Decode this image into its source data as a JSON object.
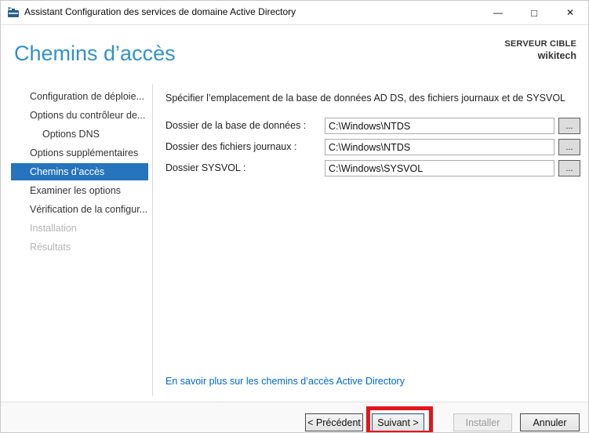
{
  "titlebar": {
    "title": "Assistant Configuration des services de domaine Active Directory",
    "controls": {
      "minimize_glyph": "—",
      "maximize_glyph": "□",
      "close_glyph": "✕"
    }
  },
  "header": {
    "page_title": "Chemins d’accès",
    "target_server_label": "SERVEUR CIBLE",
    "target_server_name": "wikitech"
  },
  "sidebar": {
    "items": [
      {
        "label": "Configuration de déploie...",
        "state": "normal",
        "indent": 0
      },
      {
        "label": "Options du contrôleur de...",
        "state": "normal",
        "indent": 0
      },
      {
        "label": "Options DNS",
        "state": "normal",
        "indent": 1
      },
      {
        "label": "Options supplémentaires",
        "state": "normal",
        "indent": 0
      },
      {
        "label": "Chemins d’accès",
        "state": "selected",
        "indent": 0
      },
      {
        "label": "Examiner les options",
        "state": "normal",
        "indent": 0
      },
      {
        "label": "Vérification de la configur...",
        "state": "normal",
        "indent": 0
      },
      {
        "label": "Installation",
        "state": "disabled",
        "indent": 0
      },
      {
        "label": "Résultats",
        "state": "disabled",
        "indent": 0
      }
    ]
  },
  "main": {
    "instruction": "Spécifier l’emplacement de la base de données AD DS, des fichiers journaux et de SYSVOL",
    "fields": [
      {
        "label": "Dossier de la base de données :",
        "value": "C:\\Windows\\NTDS",
        "browse_label": "..."
      },
      {
        "label": "Dossier des fichiers journaux :",
        "value": "C:\\Windows\\NTDS",
        "browse_label": "..."
      },
      {
        "label": "Dossier SYSVOL :",
        "value": "C:\\Windows\\SYSVOL",
        "browse_label": "..."
      }
    ],
    "help_link": "En savoir plus sur les chemins d’accès Active Directory"
  },
  "footer": {
    "previous_label": "< Précédent",
    "next_label": "Suivant >",
    "install_label": "Installer",
    "cancel_label": "Annuler"
  },
  "annotation": {
    "description": "red highlight rectangle around Suivant button",
    "color": "#e0161c"
  },
  "colors": {
    "selected_nav_blue": "#2574bd",
    "heading_blue": "#3392c6",
    "link_blue": "#0066cc",
    "annotation_red": "#e0161c"
  }
}
